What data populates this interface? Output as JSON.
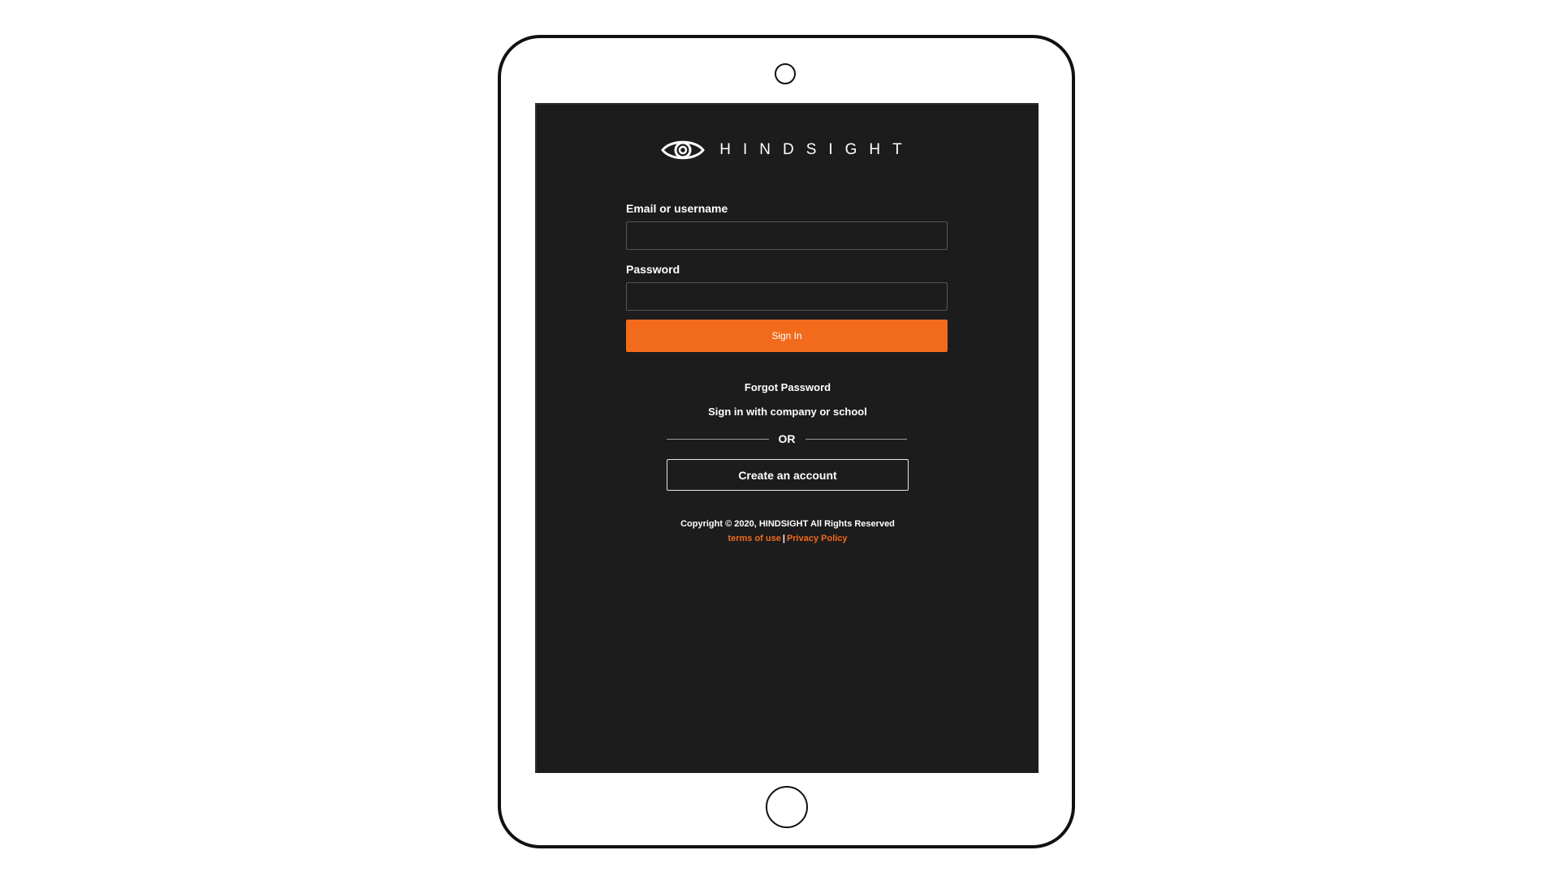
{
  "brand": {
    "name": "HINDSIGHT",
    "logo_icon": "eye-icon",
    "accent_color": "#f26a1b",
    "background_color": "#1c1c1c"
  },
  "login_form": {
    "email_label": "Email or username",
    "email_value": "",
    "email_placeholder": "",
    "password_label": "Password",
    "password_value": "",
    "password_placeholder": "",
    "sign_in_label": "Sign In"
  },
  "links": {
    "forgot_password": "Forgot Password",
    "sso_sign_in": "Sign in with company or school"
  },
  "divider": {
    "text": "OR"
  },
  "create_account_label": "Create an account",
  "footer": {
    "copyright": "Copyright © 2020, HINDSIGHT All Rights Reserved",
    "terms_label": "terms of use",
    "separator": "|",
    "privacy_label": "Privacy Policy"
  }
}
